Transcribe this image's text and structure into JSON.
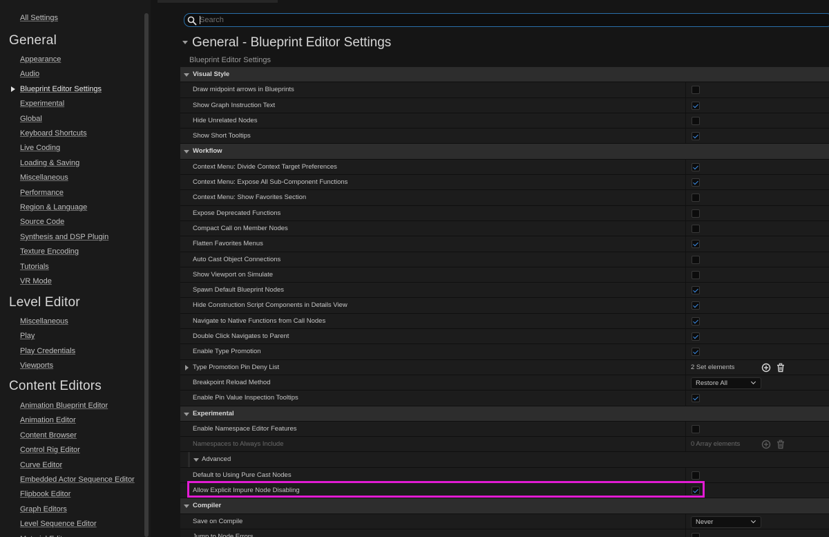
{
  "sidebar": {
    "all_settings": "All Settings",
    "sections": [
      {
        "title": "General",
        "items": [
          "Appearance",
          "Audio",
          "Blueprint Editor Settings",
          "Experimental",
          "Global",
          "Keyboard Shortcuts",
          "Live Coding",
          "Loading & Saving",
          "Miscellaneous",
          "Performance",
          "Region & Language",
          "Source Code",
          "Synthesis and DSP Plugin",
          "Texture Encoding",
          "Tutorials",
          "VR Mode"
        ]
      },
      {
        "title": "Level Editor",
        "items": [
          "Miscellaneous",
          "Play",
          "Play Credentials",
          "Viewports"
        ]
      },
      {
        "title": "Content Editors",
        "items": [
          "Animation Blueprint Editor",
          "Animation Editor",
          "Content Browser",
          "Control Rig Editor",
          "Curve Editor",
          "Embedded Actor Sequence Editor",
          "Flipbook Editor",
          "Graph Editors",
          "Level Sequence Editor",
          "Material Editor"
        ]
      }
    ],
    "active_item": "Blueprint Editor Settings"
  },
  "search": {
    "placeholder": "Search",
    "value": ""
  },
  "page": {
    "title": "General - Blueprint Editor Settings",
    "subtitle": "Blueprint Editor Settings"
  },
  "colors": {
    "accent": "#3d8ee8",
    "highlight": "#e21bd3",
    "search_border": "#2a6fa8"
  },
  "rows": [
    {
      "type": "category",
      "label": "Visual Style"
    },
    {
      "type": "bool",
      "label": "Draw midpoint arrows in Blueprints",
      "checked": false
    },
    {
      "type": "bool",
      "label": "Show Graph Instruction Text",
      "checked": true
    },
    {
      "type": "bool",
      "label": "Hide Unrelated Nodes",
      "checked": false
    },
    {
      "type": "bool",
      "label": "Show Short Tooltips",
      "checked": true
    },
    {
      "type": "category",
      "label": "Workflow"
    },
    {
      "type": "bool",
      "label": "Context Menu: Divide Context Target Preferences",
      "checked": true
    },
    {
      "type": "bool",
      "label": "Context Menu: Expose All Sub-Component Functions",
      "checked": true
    },
    {
      "type": "bool",
      "label": "Context Menu: Show Favorites Section",
      "checked": false
    },
    {
      "type": "bool",
      "label": "Expose Deprecated Functions",
      "checked": false
    },
    {
      "type": "bool",
      "label": "Compact Call on Member Nodes",
      "checked": false
    },
    {
      "type": "bool",
      "label": "Flatten Favorites Menus",
      "checked": true
    },
    {
      "type": "bool",
      "label": "Auto Cast Object Connections",
      "checked": false
    },
    {
      "type": "bool",
      "label": "Show Viewport on Simulate",
      "checked": false
    },
    {
      "type": "bool",
      "label": "Spawn Default Blueprint Nodes",
      "checked": true
    },
    {
      "type": "bool",
      "label": "Hide Construction Script Components in Details View",
      "checked": true
    },
    {
      "type": "bool",
      "label": "Navigate to Native Functions from Call Nodes",
      "checked": true
    },
    {
      "type": "bool",
      "label": "Double Click Navigates to Parent",
      "checked": true
    },
    {
      "type": "bool",
      "label": "Enable Type Promotion",
      "checked": true
    },
    {
      "type": "array",
      "label": "Type Promotion Pin Deny List",
      "value": "2 Set elements",
      "expandable": true
    },
    {
      "type": "combo",
      "label": "Breakpoint Reload Method",
      "value": "Restore All"
    },
    {
      "type": "bool",
      "label": "Enable Pin Value Inspection Tooltips",
      "checked": true
    },
    {
      "type": "category",
      "label": "Experimental"
    },
    {
      "type": "bool",
      "label": "Enable Namespace Editor Features",
      "checked": false
    },
    {
      "type": "array",
      "label": "Namespaces to Always Include",
      "value": "0 Array elements",
      "disabled": true
    },
    {
      "type": "subcategory",
      "label": "Advanced"
    },
    {
      "type": "bool",
      "label": "Default to Using Pure Cast Nodes",
      "checked": false
    },
    {
      "type": "bool",
      "label": "Allow Explicit Impure Node Disabling",
      "checked": true,
      "highlighted": true
    },
    {
      "type": "category",
      "label": "Compiler"
    },
    {
      "type": "combo",
      "label": "Save on Compile",
      "value": "Never"
    },
    {
      "type": "bool",
      "label": "Jump to Node Errors",
      "checked": false
    }
  ]
}
